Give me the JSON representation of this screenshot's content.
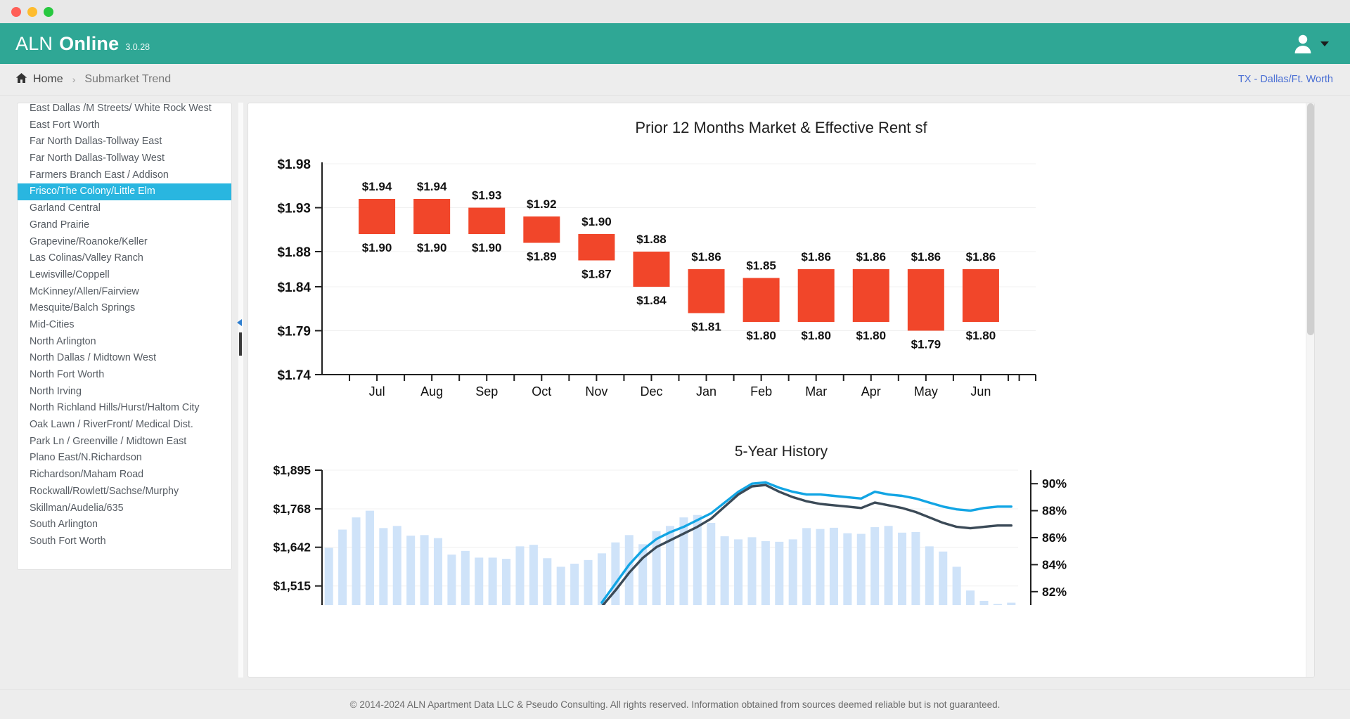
{
  "window": {
    "traffic_lights": [
      "close",
      "minimize",
      "maximize"
    ]
  },
  "appbar": {
    "brand_first": "ALN",
    "brand_second": "Online",
    "version": "3.0.28",
    "user_icon": "user-icon",
    "caret_icon": "chevron-down-icon"
  },
  "breadcrumb": {
    "home_icon": "home-icon",
    "home_label": "Home",
    "separator": "›",
    "current": "Submarket Trend",
    "region": "TX - Dallas/Ft. Worth"
  },
  "sidebar": {
    "items": [
      {
        "label": "East Dallas /M Streets/ White Rock West",
        "selected": false
      },
      {
        "label": "East Fort Worth",
        "selected": false
      },
      {
        "label": "Far North Dallas-Tollway East",
        "selected": false
      },
      {
        "label": "Far North Dallas-Tollway West",
        "selected": false
      },
      {
        "label": "Farmers Branch East / Addison",
        "selected": false
      },
      {
        "label": "Frisco/The Colony/Little Elm",
        "selected": true
      },
      {
        "label": "Garland Central",
        "selected": false
      },
      {
        "label": "Grand Prairie",
        "selected": false
      },
      {
        "label": "Grapevine/Roanoke/Keller",
        "selected": false
      },
      {
        "label": "Las Colinas/Valley Ranch",
        "selected": false
      },
      {
        "label": "Lewisville/Coppell",
        "selected": false
      },
      {
        "label": "McKinney/Allen/Fairview",
        "selected": false
      },
      {
        "label": "Mesquite/Balch Springs",
        "selected": false
      },
      {
        "label": "Mid-Cities",
        "selected": false
      },
      {
        "label": "North Arlington",
        "selected": false
      },
      {
        "label": "North Dallas / Midtown West",
        "selected": false
      },
      {
        "label": "North Fort Worth",
        "selected": false
      },
      {
        "label": "North Irving",
        "selected": false
      },
      {
        "label": "North Richland Hills/Hurst/Haltom City",
        "selected": false
      },
      {
        "label": "Oak Lawn / RiverFront/ Medical Dist.",
        "selected": false
      },
      {
        "label": "Park Ln / Greenville / Midtown East",
        "selected": false
      },
      {
        "label": "Plano East/N.Richardson",
        "selected": false
      },
      {
        "label": "Richardson/Maham Road",
        "selected": false
      },
      {
        "label": "Rockwall/Rowlett/Sachse/Murphy",
        "selected": false
      },
      {
        "label": "Skillman/Audelia/635",
        "selected": false
      },
      {
        "label": "South Arlington",
        "selected": false
      },
      {
        "label": "South Fort Worth",
        "selected": false
      }
    ]
  },
  "colors": {
    "brand_teal": "#2fa795",
    "selection_blue": "#29b6e0",
    "bar_red": "#f1462a",
    "hist_bar_blue": "#cfe3f9",
    "effective_line": "#12a5e4",
    "occupancy_line": "#3b4a57",
    "link_blue": "#4a6fd4"
  },
  "footer": {
    "text": "© 2014-2024 ALN Apartment Data LLC & Pseudo Consulting. All rights reserved. Information obtained from sources deemed reliable but is not guaranteed."
  },
  "chart_data": [
    {
      "type": "bar",
      "id": "prior-12-months",
      "title": "Prior 12 Months Market & Effective Rent sf",
      "xlabel": "",
      "ylabel": "",
      "categories": [
        "Jul",
        "Aug",
        "Sep",
        "Oct",
        "Nov",
        "Dec",
        "Jan",
        "Feb",
        "Mar",
        "Apr",
        "May",
        "Jun"
      ],
      "ytick_labels": [
        "$1.98",
        "$1.93",
        "$1.88",
        "$1.84",
        "$1.79",
        "$1.74"
      ],
      "ytick_values": [
        1.98,
        1.93,
        1.88,
        1.84,
        1.79,
        1.74
      ],
      "ylim": [
        1.74,
        1.98
      ],
      "grid": true,
      "legend": "none",
      "series": [
        {
          "name": "Market Rent sf",
          "values": [
            1.94,
            1.94,
            1.93,
            1.92,
            1.9,
            1.88,
            1.86,
            1.85,
            1.86,
            1.86,
            1.86,
            1.86
          ],
          "labels": [
            "$1.94",
            "$1.94",
            "$1.93",
            "$1.92",
            "$1.90",
            "$1.88",
            "$1.86",
            "$1.85",
            "$1.86",
            "$1.86",
            "$1.86",
            "$1.86"
          ]
        },
        {
          "name": "Effective Rent sf",
          "values": [
            1.9,
            1.9,
            1.9,
            1.89,
            1.87,
            1.84,
            1.81,
            1.8,
            1.8,
            1.8,
            1.79,
            1.8
          ],
          "labels": [
            "$1.90",
            "$1.90",
            "$1.90",
            "$1.89",
            "$1.87",
            "$1.84",
            "$1.81",
            "$1.80",
            "$1.80",
            "$1.80",
            "$1.79",
            "$1.80"
          ]
        }
      ]
    },
    {
      "type": "bar",
      "id": "five-year-history",
      "title": "5-Year History",
      "xlabel": "",
      "ylabel": "",
      "ytick_labels": [
        "$1,895",
        "$1,768",
        "$1,642",
        "$1,515"
      ],
      "ytick_values": [
        1895,
        1768,
        1642,
        1515
      ],
      "ylim": [
        1452,
        1895
      ],
      "y2tick_labels": [
        "90%",
        "88%",
        "86%",
        "84%",
        "82%"
      ],
      "y2tick_values": [
        90,
        88,
        86,
        84,
        82
      ],
      "y2lim": [
        81,
        91
      ],
      "grid": true,
      "legend": "none",
      "bar_series": {
        "name": "Units / Rent",
        "values": [
          1640,
          1700,
          1740,
          1762,
          1705,
          1712,
          1680,
          1682,
          1672,
          1618,
          1630,
          1608,
          1608,
          1604,
          1645,
          1650,
          1606,
          1578,
          1588,
          1600,
          1622,
          1658,
          1682,
          1652,
          1695,
          1712,
          1740,
          1748,
          1722,
          1678,
          1668,
          1675,
          1662,
          1660,
          1668,
          1705,
          1702,
          1706,
          1688,
          1686,
          1708,
          1712,
          1690,
          1692,
          1645,
          1628,
          1578,
          1500,
          1466,
          1456,
          1460
        ]
      },
      "line_series": [
        {
          "name": "Effective Occupancy",
          "color": "#12a5e4",
          "values": [
            null,
            null,
            null,
            null,
            null,
            null,
            null,
            null,
            null,
            null,
            null,
            null,
            null,
            null,
            null,
            null,
            null,
            null,
            null,
            null,
            81.2,
            82.6,
            84.0,
            85.1,
            85.9,
            86.4,
            86.8,
            87.3,
            87.8,
            88.6,
            89.4,
            90.0,
            90.1,
            89.7,
            89.4,
            89.2,
            89.2,
            89.1,
            89.0,
            88.9,
            89.4,
            89.2,
            89.1,
            88.9,
            88.6,
            88.3,
            88.1,
            88.0,
            88.2,
            88.3,
            88.3
          ]
        },
        {
          "name": "Occupancy",
          "color": "#3b4a57",
          "values": [
            null,
            null,
            null,
            null,
            null,
            null,
            null,
            null,
            null,
            null,
            null,
            null,
            null,
            null,
            null,
            null,
            null,
            null,
            null,
            null,
            80.9,
            82.1,
            83.4,
            84.5,
            85.3,
            85.8,
            86.3,
            86.8,
            87.4,
            88.3,
            89.2,
            89.8,
            89.9,
            89.4,
            89.0,
            88.7,
            88.5,
            88.4,
            88.3,
            88.2,
            88.6,
            88.4,
            88.2,
            87.9,
            87.5,
            87.1,
            86.8,
            86.7,
            86.8,
            86.9,
            86.9
          ]
        }
      ]
    }
  ]
}
